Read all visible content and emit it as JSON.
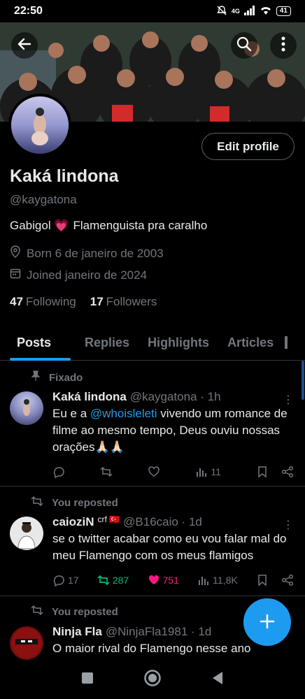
{
  "status_bar": {
    "time": "22:50",
    "network": "4G",
    "battery": "41"
  },
  "profile": {
    "name": "Kaká lindona",
    "handle": "@kaygatona",
    "bio_left": "Gabigol 💗",
    "bio_right": "Flamenguista pra caralho",
    "born": "Born 6 de janeiro de 2003",
    "joined": "Joined janeiro de 2024",
    "following_count": "47",
    "following_label": "Following",
    "followers_count": "17",
    "followers_label": "Followers",
    "edit_label": "Edit profile"
  },
  "tabs": [
    {
      "label": "Posts",
      "active": true
    },
    {
      "label": "Replies",
      "active": false
    },
    {
      "label": "Highlights",
      "active": false
    },
    {
      "label": "Articles",
      "active": false
    }
  ],
  "posts": [
    {
      "context": "Fixado",
      "name": "Kaká lindona",
      "meta": "@kaygatona · 1h",
      "text_before": "Eu e a ",
      "mention": "@whoisleleti",
      "text_after": " vivendo um romance de filme ao mesmo tempo, Deus ouviu nossas orações🙏🏻🙏🏻",
      "replies": "",
      "reposts": "",
      "likes": "",
      "views": "11"
    },
    {
      "context": "You reposted",
      "name": "caioziN",
      "badge": "crf 🇹🇷",
      "meta": "@B16caio · 1d",
      "text": "se o twitter acabar como eu vou falar mal do meu Flamengo com os meus flamigos",
      "replies": "17",
      "reposts": "287",
      "likes": "751",
      "views": "11,8K"
    },
    {
      "context": "You reposted",
      "name": "Ninja Fla",
      "meta": "@NinjaFla1981 · 1d",
      "text": "O maior rival do Flamengo nesse ano"
    }
  ],
  "colors": {
    "accent": "#1d9bf0",
    "repost_active": "#00ba7c",
    "like_active": "#f91880",
    "muted": "#71767b"
  }
}
